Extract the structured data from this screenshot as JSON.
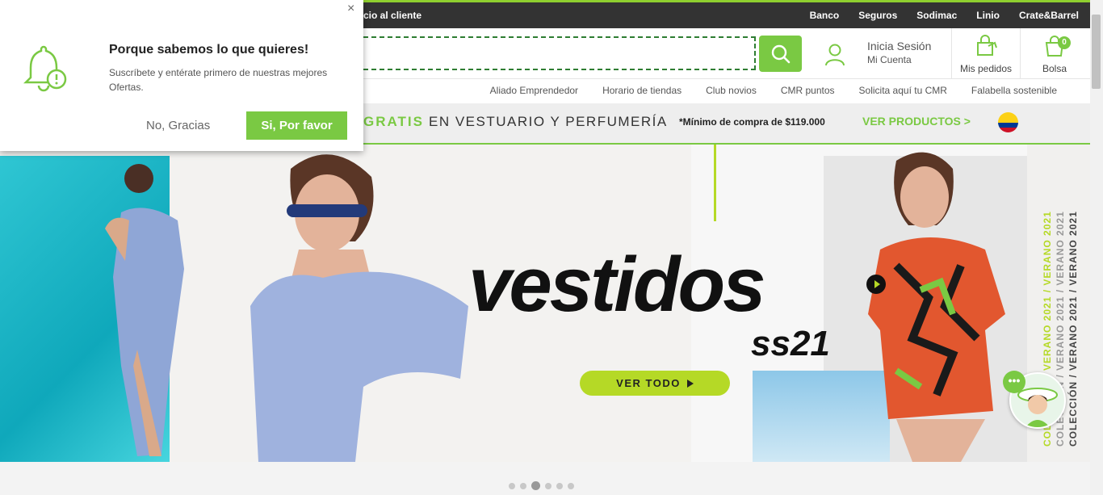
{
  "topbar": {
    "service": "vicio al cliente",
    "links": [
      "Banco",
      "Seguros",
      "Sodimac",
      "Linio",
      "Crate&Barrel"
    ]
  },
  "header": {
    "search": {
      "value": "",
      "placeholder": ""
    },
    "account": {
      "line1": "Inicia Sesión",
      "line2": "Mi Cuenta"
    },
    "orders_label": "Mis pedidos",
    "bag_label": "Bolsa",
    "bag_count": "0"
  },
  "subnav": [
    "Aliado Emprendedor",
    "Horario de tiendas",
    "Club novios",
    "CMR puntos",
    "Solicita aquí tu CMR",
    "Falabella sostenible"
  ],
  "promo": {
    "highlight": "GRATIS",
    "category": "EN VESTUARIO Y PERFUMERÍA",
    "minimum": "*Mínimo de compra de $119.000",
    "link": "VER PRODUCTOS >"
  },
  "hero": {
    "headline": "vestidos",
    "subheadline": "ss21",
    "cta": "VER TODO",
    "side_text": "COLECCIÓN / VERANO 2021 / VERANO 2021"
  },
  "popup": {
    "close": "×",
    "title": "Porque sabemos lo que quieres!",
    "message": "Suscríbete y entérate primero de nuestras mejores Ofertas.",
    "decline": "No, Gracias",
    "accept": "Si, Por favor"
  },
  "carousel": {
    "slides": 6,
    "active": 3
  },
  "colors": {
    "accent": "#7ac943",
    "lime": "#b5d926",
    "dark": "#333333"
  }
}
